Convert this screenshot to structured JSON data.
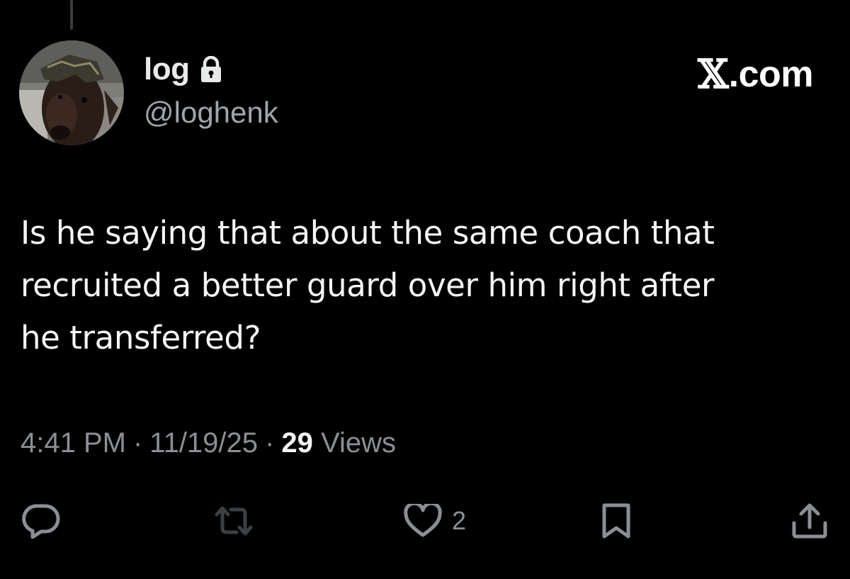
{
  "author": {
    "display_name": "log",
    "handle": "@loghenk",
    "protected_icon": "lock-icon",
    "avatar_icon": "dog-avatar"
  },
  "brand": {
    "mark": "𝕏",
    "domain": ".com"
  },
  "tweet": {
    "lines": [
      "Is he saying that about the same coach that",
      "recruited a better guard over him right after",
      "he transferred?"
    ]
  },
  "meta": {
    "time": "4:41 PM",
    "separator": "·",
    "date": "11/19/25",
    "views_count": "29",
    "views_label": "Views"
  },
  "actions": {
    "reply_icon": "reply-icon",
    "repost_icon": "repost-icon",
    "like_icon": "heart-icon",
    "like_count": "2",
    "bookmark_icon": "bookmark-icon",
    "share_icon": "share-icon"
  },
  "colors": {
    "background": "#000000",
    "text_primary": "#e7e9ea",
    "text_secondary": "#8b8f93"
  }
}
